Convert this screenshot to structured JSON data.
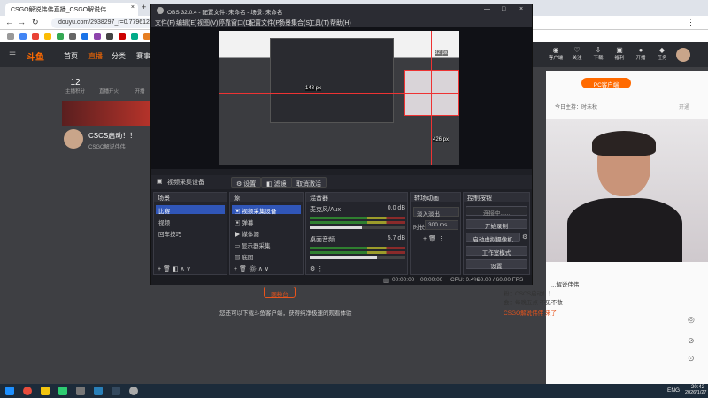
{
  "browser": {
    "tab_title": "CSGO解说伟伟直播_CSGO解说伟...",
    "tab_close": "×",
    "new_tab": "+",
    "url": "douyu.com/2938297_r=0.7796127",
    "window_controls": [
      "—",
      "□",
      "×"
    ]
  },
  "site": {
    "logo": "斗鱼",
    "nav": [
      "首页",
      "直播",
      "分类",
      "赛事"
    ],
    "stats": [
      {
        "value": "12",
        "label": "主播积分"
      },
      {
        "value": "",
        "label": "直播开火"
      },
      {
        "value": "",
        "label": "开播"
      }
    ],
    "streamer_name": "CSCS启动！！",
    "streamer_tag": "CSGO解说伟伟",
    "header_icons": [
      {
        "icon": "record-icon",
        "label": "客户端"
      },
      {
        "icon": "follow-icon",
        "label": "关注"
      },
      {
        "icon": "download-icon",
        "label": "下载"
      },
      {
        "icon": "gift-icon",
        "label": "福利"
      },
      {
        "icon": "record-icon",
        "label": "开播"
      },
      {
        "icon": "task-icon",
        "label": "任务"
      }
    ],
    "pc_badge": "PC客户端",
    "notice_title": "今日主持：时未秋",
    "notice_btn": "开通",
    "open_platform_btn": "圈粉台",
    "open_platform_text": "您还可以下载斗鱼客户端，获得纯净极速的观看体验"
  },
  "chat": {
    "messages": [
      "...解说伟伟",
      "粉：CSCS启动！！",
      "会：每晚五点 不见不散",
      "CSGO解说伟伟 来了"
    ]
  },
  "obs": {
    "title": "OBS 32.0.4 - 配置文件: 未命名 - 场景: 未命名",
    "menu": [
      "文件(F)",
      "编辑(E)",
      "视图(V)",
      "停靠窗口(D)",
      "配置文件(P)",
      "场景集合(S)",
      "工具(T)",
      "帮助(H)"
    ],
    "preview_label_left": "148 px",
    "preview_label_top": "32 px",
    "preview_label_right": "426 px",
    "source_name": "视频采集设备",
    "source_buttons": [
      "设置",
      "滤镜",
      "取消激活"
    ],
    "docks": {
      "scenes": {
        "title": "场景",
        "items": [
          "比赛",
          "视频",
          "回车技巧"
        ]
      },
      "sources": {
        "title": "源",
        "items": [
          "视频采集设备",
          "弹幕",
          "媒体源",
          "显示器采集",
          "底图"
        ]
      },
      "mixer": {
        "title": "混音器",
        "channels": [
          {
            "name": "麦克风/Aux",
            "db": "0.0 dB",
            "level": 0.55
          },
          {
            "name": "桌面音频",
            "db": "5.7 dB",
            "level": 0.7
          }
        ]
      },
      "transitions": {
        "title": "转场动画",
        "type": "淡入淡出",
        "duration_label": "时长",
        "duration": "300 ms"
      },
      "controls": {
        "title": "控制按钮",
        "status": "连接中......",
        "buttons": [
          "开始录制",
          "启动虚拟摄像机",
          "工作室模式",
          "设置"
        ]
      }
    },
    "status": {
      "time1": "00:00:00",
      "time2": "00:00:00",
      "cpu": "CPU: 0.4%",
      "fps": "60.00 / 60.00 FPS"
    }
  },
  "taskbar": {
    "lang": "ENG",
    "time": "20:42",
    "date": "2026/1/27"
  }
}
